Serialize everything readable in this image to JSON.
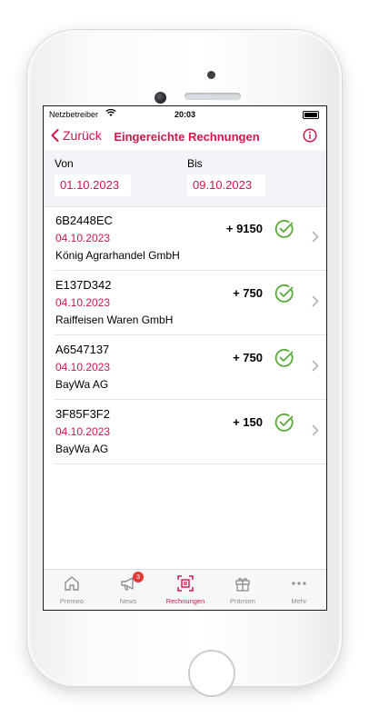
{
  "status": {
    "carrier": "Netzbetreiber",
    "time": "20:03"
  },
  "nav": {
    "back_label": "Zurück",
    "title": "Eingereichte Rechnungen"
  },
  "filter": {
    "from_label": "Von",
    "from_value": "01.10.2023",
    "to_label": "Bis",
    "to_value": "09.10.2023"
  },
  "invoices": [
    {
      "number": "6B2448EC",
      "date": "04.10.2023",
      "company": "König Agrarhandel GmbH",
      "points": "+ 9150",
      "status": "checked"
    },
    {
      "number": "E137D342",
      "date": "04.10.2023",
      "company": "Raiffeisen Waren GmbH",
      "points": "+ 750",
      "status": "checked"
    },
    {
      "number": "A6547137",
      "date": "04.10.2023",
      "company": "BayWa AG",
      "points": "+ 750",
      "status": "checked"
    },
    {
      "number": "3F85F3F2",
      "date": "04.10.2023",
      "company": "BayWa AG",
      "points": "+ 150",
      "status": "checked"
    }
  ],
  "tabs": [
    {
      "label": "Premeo",
      "icon": "home-icon"
    },
    {
      "label": "News",
      "icon": "megaphone-icon",
      "badge": "3"
    },
    {
      "label": "Rechnungen",
      "icon": "scan-receipt-icon",
      "active": true
    },
    {
      "label": "Prämien",
      "icon": "gift-icon"
    },
    {
      "label": "Mehr",
      "icon": "more-dots-icon"
    }
  ],
  "colors": {
    "accent": "#d0164c",
    "success": "#5aa83a",
    "badge": "#e53935"
  }
}
